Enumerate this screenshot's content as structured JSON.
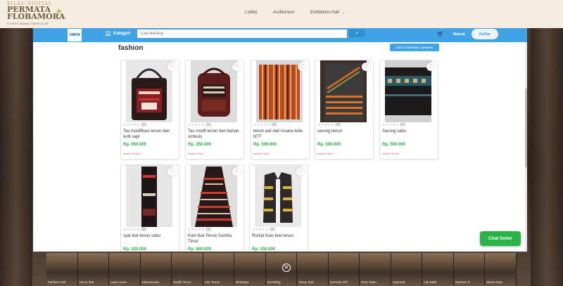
{
  "header": {
    "logo_line1": "KILAU DIGITAL",
    "logo_line2": "PERMATA",
    "logo_line3": "FLOBAMORA",
    "logo_line4": "FLORES SUMBA TIMOR ALOR",
    "nav": [
      "Lobby",
      "Auditorium",
      "Exhibition Hall"
    ]
  },
  "store_bar": {
    "logo_text": "UMKM",
    "kategori_label": "Kategori",
    "search_placeholder": "Cari Barang",
    "login_label": "Masuk",
    "register_label": "Daftar"
  },
  "section": {
    "title": "fashion",
    "see_more_label": "LIHAT FASHION LAINNYA"
  },
  "products": [
    {
      "name": "Tas modifikasi tenun dan kulit sapi",
      "price": "Rp. 950.000",
      "rating_count": "(0)",
      "sold": "terkirim 59 stok"
    },
    {
      "name": "Tas modif tenun dan bahan sintesis",
      "price": "Rp. 250.000",
      "rating_count": "(0)",
      "sold": "terkirim 9 stok"
    },
    {
      "name": "tenun asli dari insana kefa NTT",
      "price": "Rp. 500.000",
      "rating_count": "(0)",
      "sold": "terkirim 9 stok"
    },
    {
      "name": "sarung tenun",
      "price": "Rp. 500.000",
      "rating_count": "(0)",
      "sold": "terkirim 9 stok"
    },
    {
      "name": "Sarung sabu",
      "price": "Rp. 500.000",
      "rating_count": "(0)",
      "sold": "terkirim 18 stok"
    },
    {
      "name": "syal ikat tenun sabu",
      "price": "Rp. 125.000",
      "rating_count": "(0)",
      "sold": ""
    },
    {
      "name": "Kain Ikat Tenun Sumba Timur",
      "price": "Rp. 600.000",
      "rating_count": "(0)",
      "sold": ""
    },
    {
      "name": "Rompi Kain Ikat tenun",
      "price": "Rp. 150.000",
      "rating_count": "(0)",
      "sold": ""
    }
  ],
  "chat_label": "Chat Seller",
  "halls": [
    "Fashion Hall",
    "Tenun Ikat",
    "Lepo Lorun",
    "Dekranasda",
    "Disdik Tenun",
    "Alor Tenun",
    "Bintang's",
    "Kemeling",
    "Tenun Dari",
    "Komodo Gift",
    "Rote Ndao",
    "Cajo's69",
    "Lilo Batik",
    "Warisan R",
    "Mama Mau"
  ],
  "colors": {
    "accent": "#3fa3e6",
    "price": "#27ae3f",
    "chat": "#2bb34a"
  }
}
